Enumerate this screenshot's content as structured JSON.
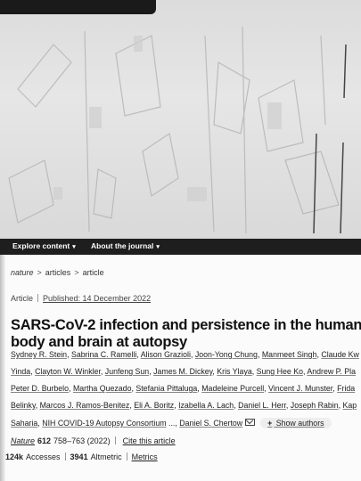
{
  "nav": {
    "explore": "Explore content",
    "about": "About the journal"
  },
  "breadcrumb": {
    "home": "nature",
    "section": "articles",
    "current": "article"
  },
  "article": {
    "type": "Article",
    "published": "Published: 14 December 2022",
    "title_line1": "SARS-CoV-2 infection and persistence in the human",
    "title_line2": "body and brain at autopsy"
  },
  "authors": [
    [
      "Sydney R. Stein",
      "Sabrina C. Ramelli",
      "Alison Grazioli",
      "Joon-Yong Chung",
      "Manmeet Singh",
      "Claude Kw"
    ],
    [
      "Yinda",
      "Clayton W. Winkler",
      "Junfeng Sun",
      "James M. Dickey",
      "Kris Ylaya",
      "Sung Hee Ko",
      "Andrew P. Pla"
    ],
    [
      "Peter D. Burbelo",
      "Martha Quezado",
      "Stefania Pittaluga",
      "Madeleine Purcell",
      "Vincent J. Munster",
      "Frida"
    ],
    [
      "Belinky",
      "Marcos J. Ramos-Benitez",
      "Eli A. Boritz",
      "Izabella A. Lach",
      "Daniel L. Herr",
      "Joseph Rabin",
      "Kap"
    ],
    [
      "Saharia",
      "NIH COVID-19 Autopsy Consortium",
      "...",
      "Daniel S. Chertow"
    ]
  ],
  "show_authors": "Show authors",
  "citation": {
    "journal": "Nature",
    "volume": "612",
    "pages": "758–763 (2022)",
    "cite": "Cite this article"
  },
  "metrics": {
    "accesses_value": "124k",
    "accesses_label": "Accesses",
    "altmetric_value": "3941",
    "altmetric_label": "Altmetric",
    "metrics_link": "Metrics"
  },
  "icons": [
    "mail-icon",
    "chevron-down-icon",
    "plus-icon"
  ]
}
